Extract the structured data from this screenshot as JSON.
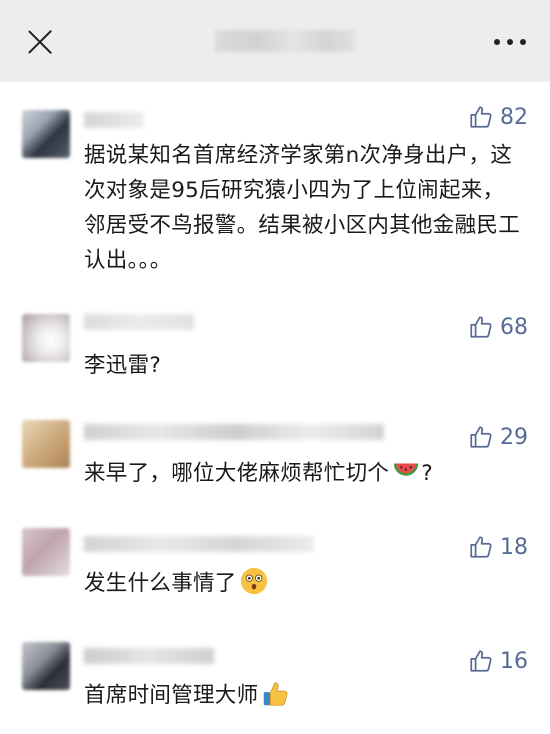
{
  "topbar": {
    "close_icon": "close-icon",
    "more_icon": "more-dots-icon"
  },
  "comments": [
    {
      "likes": "82",
      "text": "据说某知名首席经济学家第n次净身出户，这次对象是95后研究猿小四为了上位闹起来，邻居受不鸟报警。结果被小区内其他金融民工认出。。。"
    },
    {
      "likes": "68",
      "text": "李迅雷?"
    },
    {
      "likes": "29",
      "text": "来早了，哪位大佬麻烦帮忙切个",
      "text_after": "?",
      "emoji": "watermelon-emoji"
    },
    {
      "likes": "18",
      "text": "发生什么事情了",
      "emoji": "astonished-face-emoji"
    },
    {
      "likes": "16",
      "text": "首席时间管理大师",
      "emoji": "thumbs-up-emoji"
    }
  ],
  "colors": {
    "like": "#576b95",
    "text": "#1a1a1a",
    "background": "#ededed"
  }
}
